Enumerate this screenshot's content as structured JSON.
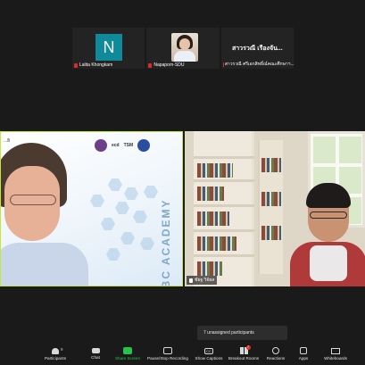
{
  "thumbnails": [
    {
      "name": "Lalita Khongkam",
      "avatar_letter": "N",
      "avatar_color": "#0e8a9a"
    },
    {
      "name": "Napaporn-SDU"
    },
    {
      "display_name": "สาวรวณี เรืองจัน...",
      "name": "สาวรวณี ศรีเอกสิทธิ์ณ์คณะศึกษาฯ..."
    }
  ],
  "main_left": {
    "top_label": "...ยิ",
    "slide_text": "ABC ACADEMY",
    "slide_logos": [
      "logo-1",
      "ecd",
      "TSM",
      "UMS"
    ]
  },
  "main_right": {
    "name": "ชัยฐ วิจัยส"
  },
  "popup": {
    "text": "7 unassigned participants"
  },
  "toolbar": {
    "participants_label": "Participants",
    "participants_count": "9",
    "chat_label": "Chat",
    "share_label": "Share Screen",
    "record_label": "Pause/Stop Recording",
    "captions_label": "Show Captions",
    "breakout_label": "Breakout Rooms",
    "breakout_badge": "7",
    "reactions_label": "Reactions",
    "apps_label": "Apps",
    "whiteboards_label": "Whiteboards"
  },
  "colors": {
    "accent_green": "#25c34a",
    "speaker_border": "#c6e63a",
    "mute_red": "#e02a2a"
  }
}
